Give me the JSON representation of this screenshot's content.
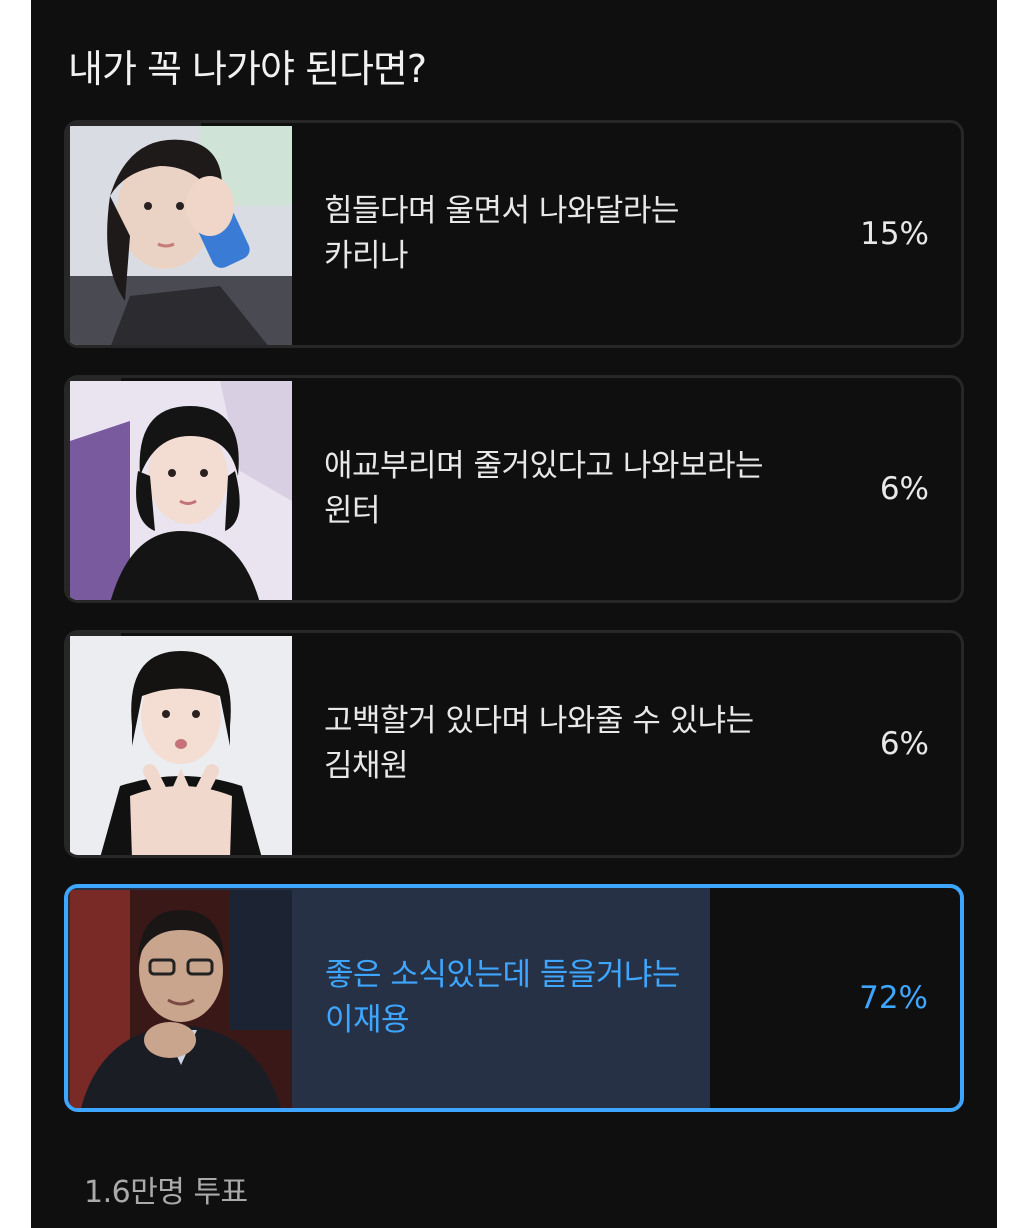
{
  "poll": {
    "question": "내가 꼭 나가야 된다면?",
    "options": [
      {
        "label_line1": "힘들다며 울면서 나와달라는",
        "label_line2": "카리나",
        "percent": "15%",
        "value": 15,
        "image": "karina-photo",
        "selected": false
      },
      {
        "label_line1": "애교부리며 줄거있다고 나와보라는",
        "label_line2": "윈터",
        "percent": "6%",
        "value": 6,
        "image": "winter-photo",
        "selected": false
      },
      {
        "label_line1": "고백할거 있다며 나와줄 수 있냐는",
        "label_line2": "김채원",
        "percent": "6%",
        "value": 6,
        "image": "kim-chaewon-photo",
        "selected": false
      },
      {
        "label_line1": "좋은 소식있는데 들을거냐는",
        "label_line2": "이재용",
        "percent": "72%",
        "value": 72,
        "image": "lee-jaeyong-photo",
        "selected": true
      }
    ],
    "vote_count": "1.6만명 투표"
  },
  "colors": {
    "background": "#0f0f0f",
    "fill": "#272727",
    "selected_fill": "#263145",
    "accent": "#3ea6ff",
    "text": "#e8e8e8"
  }
}
